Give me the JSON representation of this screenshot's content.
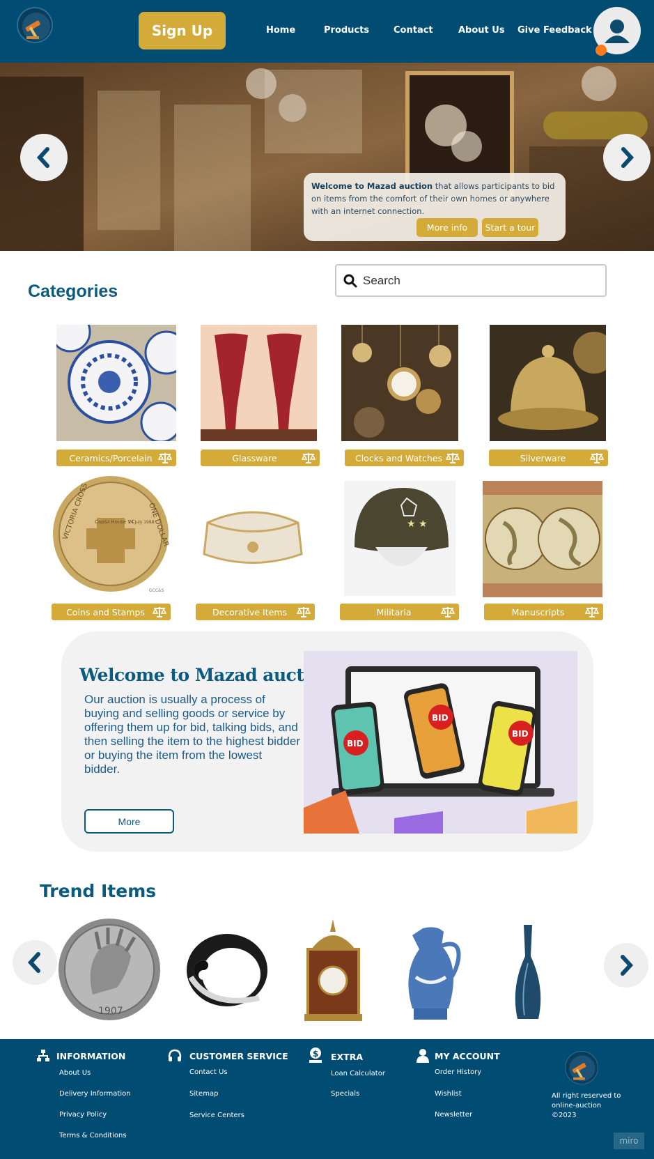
{
  "header": {
    "signup_label": "Sign Up",
    "nav": [
      "Home",
      "Products",
      "Contact",
      "About Us",
      "Give Feedback"
    ]
  },
  "hero": {
    "brand": "Welcome to Mazad auction",
    "text": " that allows participants to bid on items from the comfort of their own homes or anywhere with an internet connection.",
    "more_info": "More info",
    "tour": "Start a tour"
  },
  "categories": {
    "title": "Categories",
    "search_placeholder": "Search",
    "items": [
      "Ceramics/Porcelain",
      "Glassware",
      "Clocks and Watches",
      "Silverware",
      "Coins and Stamps",
      "Decorative Items",
      "Militaria",
      "Manuscripts"
    ]
  },
  "welcome": {
    "title": "Welcome to Mazad auction",
    "text": "Our auction is usually a process of buying and selling goods or service by offering them up for bid, talking bids, and then selling the item to the highest bidder or buying the item from the lowest bidder.",
    "more_label": "More",
    "bid_label": "BID"
  },
  "trend": {
    "title": "Trend Items",
    "coin_year": "1907"
  },
  "coin_text": {
    "left": "VICTORIA CROSS",
    "right": "ONE DOLLAR",
    "top": "Cap&I House VC",
    "date": "24 July 1988",
    "mark": "GCC&S"
  },
  "footer": {
    "sections": [
      {
        "title": "INFORMATION",
        "links": [
          "About Us",
          "Delivery Information",
          "Privacy Policy",
          "Terms & Conditions"
        ]
      },
      {
        "title": "CUSTOMER SERVICE",
        "links": [
          "Contact Us",
          "Sitemap",
          "Service Centers"
        ]
      },
      {
        "title": "EXTRA",
        "links": [
          "Loan Calculator",
          "Specials"
        ]
      },
      {
        "title": "MY ACCOUNT",
        "links": [
          "Order History",
          "Wishlist",
          "Newsletter"
        ]
      }
    ],
    "rights": "All right reserved to online-auction ©2023",
    "watermark": "miro"
  },
  "colors": {
    "navy": "#004c73",
    "gold": "#d4ab38",
    "accent_orange": "#ff7a1a",
    "title_blue": "#0b5a80"
  }
}
